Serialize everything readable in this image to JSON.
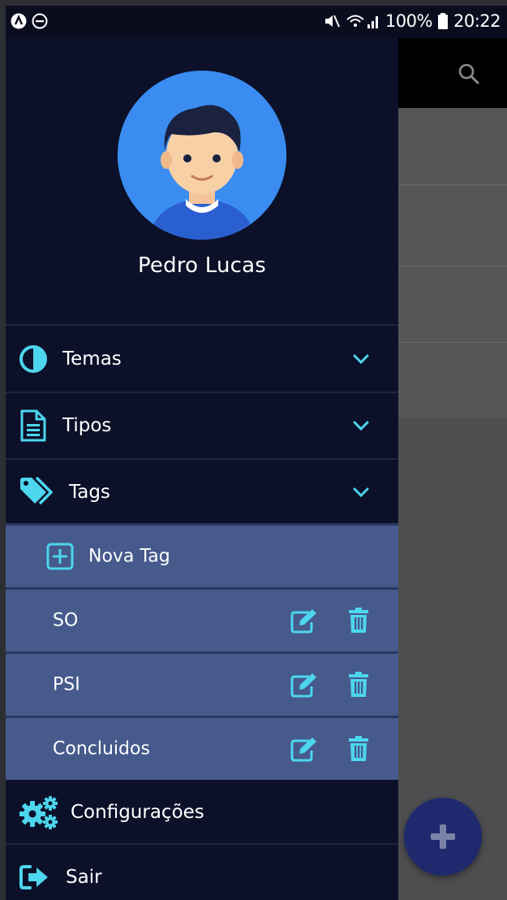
{
  "status_bar": {
    "battery": "100%",
    "time": "20:22"
  },
  "drawer": {
    "user_name": "Pedro Lucas",
    "menu": [
      {
        "label": "Temas",
        "icon": "half-circle-icon"
      },
      {
        "label": "Tipos",
        "icon": "document-icon"
      },
      {
        "label": "Tags",
        "icon": "tags-icon"
      }
    ],
    "tags": {
      "new_label": "Nova Tag",
      "items": [
        {
          "label": "SO"
        },
        {
          "label": "PSI"
        },
        {
          "label": "Concluidos"
        }
      ]
    },
    "footer": [
      {
        "label": "Configurações",
        "icon": "gears-icon"
      },
      {
        "label": "Sair",
        "icon": "sign-out-icon"
      }
    ]
  },
  "colors": {
    "drawer_bg": "#0c1129",
    "accent": "#4dd6ee",
    "tag_item_bg": "#465a8c",
    "fab": "#1f2a6e",
    "avatar_bg": "#3a8cf0"
  }
}
